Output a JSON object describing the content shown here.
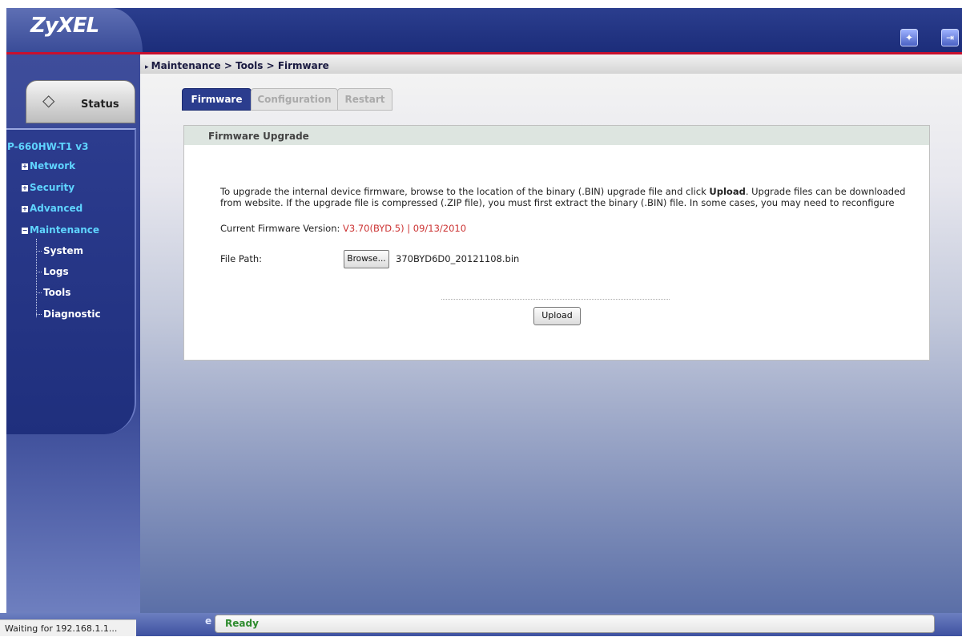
{
  "app": {
    "logo": "ZyXEL"
  },
  "header": {
    "wizard_icon": "wizard-icon",
    "logout_icon": "logout-icon",
    "breadcrumb": "Maintenance > Tools > Firmware"
  },
  "sidebar": {
    "status_label": "Status",
    "model": "P-660HW-T1 v3",
    "items": [
      {
        "label": "Network"
      },
      {
        "label": "Security"
      },
      {
        "label": "Advanced"
      },
      {
        "label": "Maintenance"
      }
    ],
    "subitems": [
      {
        "label": "System"
      },
      {
        "label": "Logs"
      },
      {
        "label": "Tools"
      },
      {
        "label": "Diagnostic"
      }
    ]
  },
  "tabs": [
    {
      "label": "Firmware"
    },
    {
      "label": "Configuration"
    },
    {
      "label": "Restart"
    }
  ],
  "panel": {
    "title": "Firmware Upgrade",
    "desc_prefix": "To upgrade the internal device firmware, browse to the location of the binary (.BIN) upgrade file and click ",
    "desc_bold": "Upload",
    "desc_suffix": ". Upgrade files can be downloaded from website. If the upgrade file is compressed (.ZIP file), you must first extract the binary (.BIN) file. In some cases, you may need to reconfigure",
    "fw_label": "Current Firmware Version: ",
    "fw_value": "V3.70(BYD.5) | 09/13/2010",
    "file_path_label": "File Path:",
    "browse_label": "Browse...",
    "file_name": "370BYD6D0_20121108.bin",
    "upload_label": "Upload"
  },
  "status": {
    "browser_status": "Waiting for 192.168.1.1...",
    "left_letter": "e",
    "ready": "Ready"
  },
  "colors": {
    "brand_blue": "#2b3d8e",
    "accent_cyan": "#5fd4ff",
    "firmware_red": "#cc3333",
    "ready_green": "#2e8b2e"
  }
}
